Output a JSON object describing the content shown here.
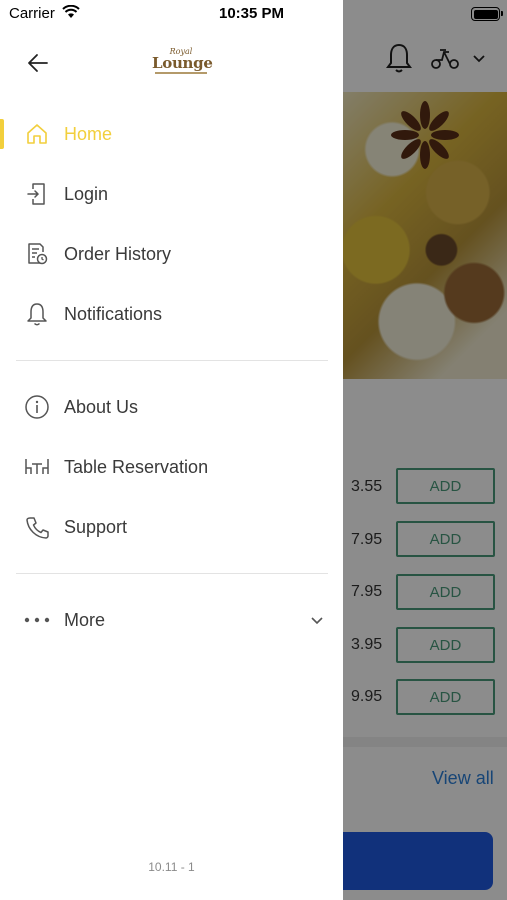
{
  "status_bar": {
    "carrier": "Carrier",
    "time": "10:35 PM"
  },
  "drawer": {
    "logo": {
      "script": "Royal",
      "main": "Lounge"
    },
    "items": [
      {
        "label": "Home",
        "icon": "home-icon",
        "active": true
      },
      {
        "label": "Login",
        "icon": "login-icon"
      },
      {
        "label": "Order History",
        "icon": "order-history-icon"
      },
      {
        "label": "Notifications",
        "icon": "bell-icon"
      },
      {
        "label": "About Us",
        "icon": "info-icon"
      },
      {
        "label": "Table Reservation",
        "icon": "table-icon"
      },
      {
        "label": "Support",
        "icon": "phone-icon"
      },
      {
        "label": "More",
        "icon": "more-dots-icon"
      }
    ],
    "version": "10.11 - 1"
  },
  "background": {
    "prices": [
      "3.55",
      "7.95",
      "7.95",
      "3.95",
      "9.95"
    ],
    "add_label": "ADD",
    "view_all": "View all"
  },
  "colors": {
    "accent": "#f2cf3c",
    "add_green": "#4a9a7a",
    "link_blue": "#2b7fd8",
    "cta_blue": "#1f5ae0"
  }
}
